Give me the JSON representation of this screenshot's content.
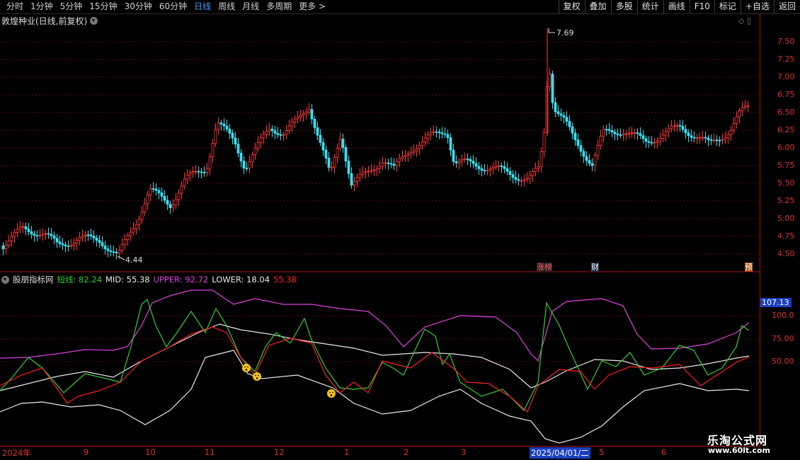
{
  "toolbar": {
    "periods": [
      "分时",
      "1分钟",
      "5分钟",
      "15分钟",
      "30分钟",
      "60分钟",
      "日线",
      "周线",
      "月线",
      "多周期",
      "更多 >"
    ],
    "active_period": "日线",
    "actions": [
      "复权",
      "叠加",
      "多股",
      "统计",
      "画线",
      "F10",
      "标记",
      "+自选",
      "返回"
    ]
  },
  "stock": {
    "title": "敦煌种业(日线,前复权)"
  },
  "price_axis": [
    "7.50",
    "7.25",
    "7.00",
    "6.75",
    "6.50",
    "6.25",
    "6.00",
    "5.75",
    "5.50",
    "5.25",
    "5.00",
    "4.75",
    "4.50"
  ],
  "price_labels": {
    "high": "7.69",
    "low": "4.44"
  },
  "markers": {
    "zhangbang": "涨榜",
    "cai": "财",
    "yu": "预"
  },
  "indicator": {
    "name": "股朋指标网",
    "short_label": "短线: 82.24",
    "mid_label": "MID: 55.38",
    "upper_label": "UPPER: 92.72",
    "lower_label": "LOWER: 18.04",
    "extra_label": "55.38",
    "current_value": "107.13",
    "axis": [
      "100.0",
      "75.00",
      "50.00"
    ]
  },
  "dates": [
    "2024年",
    "9",
    "10",
    "11",
    "12",
    "1",
    "2",
    "3",
    "2025/04/01/二",
    "5",
    "6"
  ],
  "watermark": {
    "name": "乐淘公式网",
    "url": "www.60lt.com"
  },
  "colors": {
    "up": "#ff3b3b",
    "down": "#38e0f0",
    "upper": "#e040e0",
    "mid": "#e8e8e8",
    "short": "#30d030",
    "extra": "#ff2020"
  }
}
